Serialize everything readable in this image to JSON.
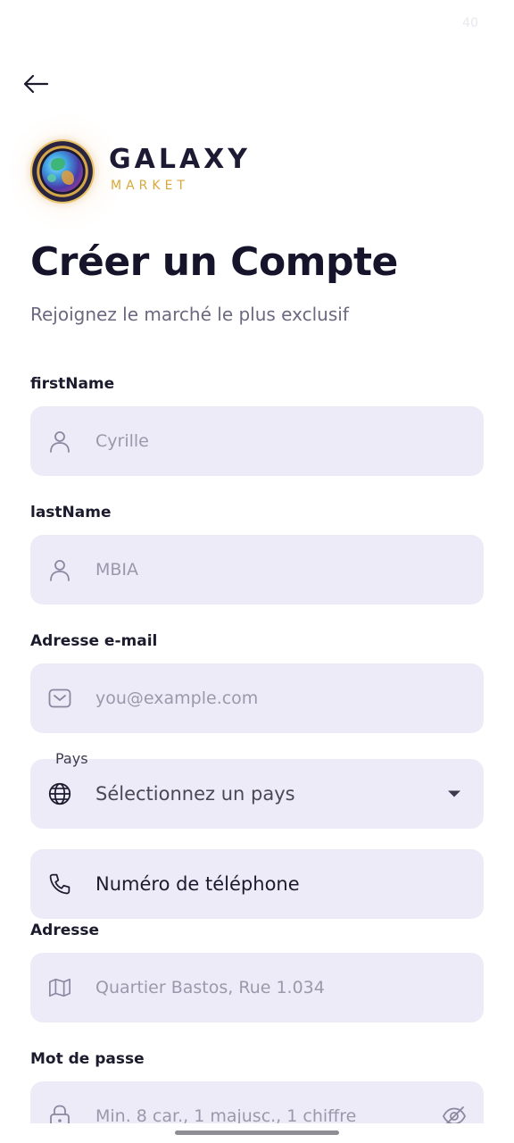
{
  "status": {
    "number": "40"
  },
  "header": {
    "back_icon": "arrow-left-icon"
  },
  "brand": {
    "name": "GALAXY",
    "sub": "MARKET",
    "accent_color": "#d7a93a"
  },
  "page": {
    "title": "Créer un Compte",
    "subtitle": "Rejoignez le marché le plus exclusif"
  },
  "form": {
    "first_name": {
      "label": "firstName",
      "placeholder": "Cyrille",
      "icon": "user-icon"
    },
    "last_name": {
      "label": "lastName",
      "placeholder": "MBIA",
      "icon": "user-icon"
    },
    "email": {
      "label": "Adresse e-mail",
      "placeholder": "you@example.com",
      "icon": "mail-icon"
    },
    "country": {
      "label": "Pays",
      "value": "Sélectionnez un pays",
      "icon": "globe-icon"
    },
    "phone": {
      "placeholder": "Numéro de téléphone",
      "icon": "phone-icon"
    },
    "address": {
      "label": "Adresse",
      "placeholder": "Quartier Bastos, Rue 1.034",
      "icon": "map-icon"
    },
    "password": {
      "label": "Mot de passe",
      "placeholder": "Min. 8 car., 1 majusc., 1 chiffre",
      "icon": "lock-icon",
      "toggle_icon": "eye-off-icon"
    }
  },
  "colors": {
    "field_bg": "#eeebf8",
    "title": "#16142b",
    "placeholder": "#9b98ab"
  }
}
